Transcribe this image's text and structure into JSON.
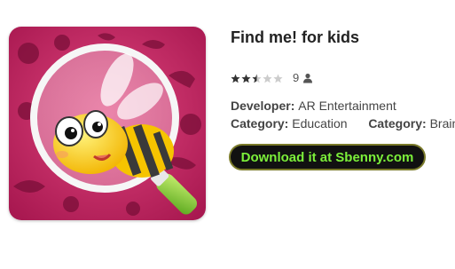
{
  "app": {
    "title": "Find me! for kids",
    "icon_name": "bee-magnifier-app-icon"
  },
  "rating": {
    "stars_value": 2.5,
    "stars_max": 5,
    "count": "9",
    "count_icon": "user-icon"
  },
  "details": {
    "developer_label": "Developer:",
    "developer_value": "AR Entertainment",
    "category_label": "Category:",
    "category_value": "Education",
    "category2_label": "Category:",
    "category2_value": "Brain G"
  },
  "download": {
    "label": "Download it at Sbenny.com"
  },
  "colors": {
    "icon_background": "#c8245e",
    "download_text": "#7cf03a",
    "download_background": "#111111",
    "star_filled": "#333333",
    "star_empty": "#cccccc"
  }
}
